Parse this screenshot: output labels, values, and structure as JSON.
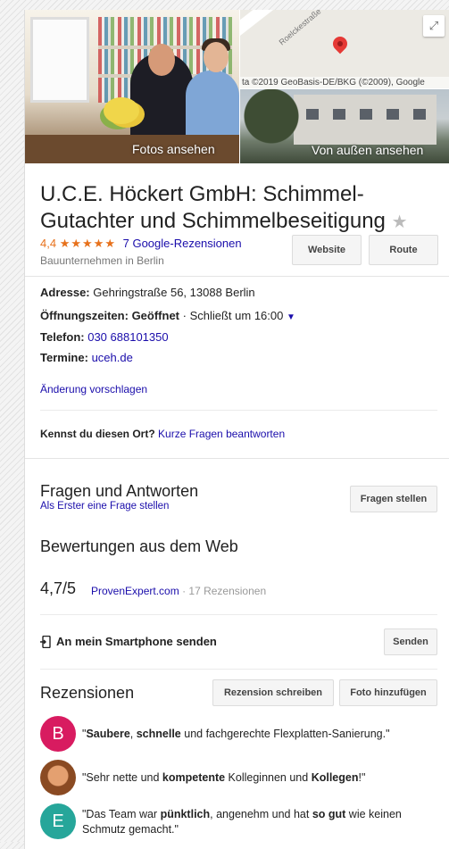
{
  "photos": {
    "main_label": "Fotos ansehen",
    "street_label": "Von außen ansehen"
  },
  "map": {
    "street_name": "Roelckestraße",
    "credit": "ta ©2019 GeoBasis-DE/BKG (©2009), Google"
  },
  "business": {
    "name": "U.C.E. Höckert GmbH: Schimmel-Gutachter und Schimmelbeseitigung",
    "rating": "4,4",
    "stars": "★★★★★",
    "reviews_link": "7 Google-Rezensionen",
    "category": "Bauunternehmen in Berlin",
    "website_button": "Website",
    "route_button": "Route"
  },
  "details": {
    "address_label": "Adresse:",
    "address_value": "Gehringstraße 56, 13088 Berlin",
    "hours_label": "Öffnungszeiten:",
    "hours_status": "Geöffnet",
    "hours_closes": "· Schließt um 16:00",
    "phone_label": "Telefon:",
    "phone_value": "030 688101350",
    "appointments_label": "Termine:",
    "appointments_value": "uceh.de",
    "suggest_edit": "Änderung vorschlagen"
  },
  "know_place": {
    "question": "Kennst du diesen Ort?",
    "link": "Kurze Fragen beantworten"
  },
  "qa": {
    "heading": "Fragen und Antworten",
    "first_link": "Als Erster eine Frage stellen",
    "ask_button": "Fragen stellen"
  },
  "web_reviews": {
    "heading": "Bewertungen aus dem Web",
    "score": "4,7/5",
    "source": "ProvenExpert.com",
    "count": "· 17 Rezensionen"
  },
  "send": {
    "label": "An mein Smartphone senden",
    "button": "Senden"
  },
  "reviews": {
    "heading": "Rezensionen",
    "write_button": "Rezension schreiben",
    "photo_button": "Foto hinzufügen",
    "items": [
      {
        "avatar_letter": "B",
        "avatar_color": "#d81b60"
      },
      {
        "avatar_letter": "",
        "avatar_color": "#b5651d"
      },
      {
        "avatar_letter": "E",
        "avatar_color": "#26a69a"
      }
    ],
    "r1_q_open": "\"",
    "r1_b1": "Saubere",
    "r1_t1": ", ",
    "r1_b2": "schnelle",
    "r1_t2": " und fachgerechte Flexplatten-Sanierung.\"",
    "r2_t1": "\"Sehr nette und ",
    "r2_b1": "kompetente",
    "r2_t2": " Kolleginnen und ",
    "r2_b2": "Kollegen",
    "r2_t3": "!\"",
    "r3_t1": "\"Das Team war ",
    "r3_b1": "pünktlich",
    "r3_t2": ", angenehm und hat ",
    "r3_b2": "so gut",
    "r3_t3": " wie keinen Schmutz gemacht.\""
  },
  "colors": {
    "accent_orange": "#e7711b",
    "link_blue": "#1a0dab"
  }
}
